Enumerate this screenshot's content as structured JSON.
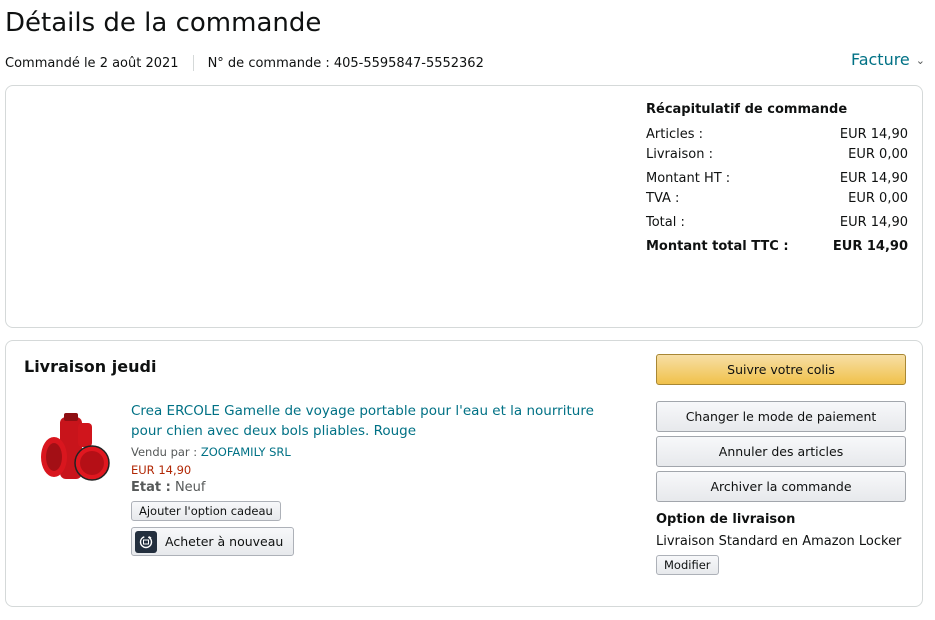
{
  "header": {
    "title": "Détails de la commande",
    "ordered_on": "Commandé le 2 août 2021",
    "order_number": "N° de commande : 405-5595847-5552362",
    "invoice_label": "Facture"
  },
  "summary": {
    "title": "Récapitulatif de commande",
    "rows": [
      {
        "label": "Articles :",
        "value": "EUR 14,90"
      },
      {
        "label": "Livraison :",
        "value": "EUR 0,00"
      },
      {
        "label": "Montant HT :",
        "value": "EUR 14,90"
      },
      {
        "label": "TVA :",
        "value": "EUR 0,00"
      },
      {
        "label": "Total :",
        "value": "EUR 14,90"
      },
      {
        "label": "Montant total TTC :",
        "value": "EUR 14,90"
      }
    ]
  },
  "delivery": {
    "title": "Livraison jeudi",
    "item": {
      "title": "Crea ERCOLE Gamelle de voyage portable pour l'eau et la nourriture pour chien avec deux bols pliables. Rouge",
      "sold_by_label": "Vendu par :",
      "seller": "ZOOFAMILY SRL",
      "price": "EUR 14,90",
      "condition_label": "Etat :",
      "condition": "Neuf",
      "gift_button": "Ajouter l'option cadeau",
      "rebuy_button": "Acheter à nouveau"
    },
    "actions": {
      "track": "Suivre votre colis",
      "change_payment": "Changer le mode de paiement",
      "cancel_items": "Annuler des articles",
      "archive_order": "Archiver la commande"
    },
    "shipping_option": {
      "title": "Option de livraison",
      "text": "Livraison Standard en Amazon Locker",
      "modify_button": "Modifier"
    }
  },
  "colors": {
    "link": "#007185",
    "price": "#b12704",
    "primary_button": "#f0c14b",
    "border": "#d5d9d9"
  }
}
